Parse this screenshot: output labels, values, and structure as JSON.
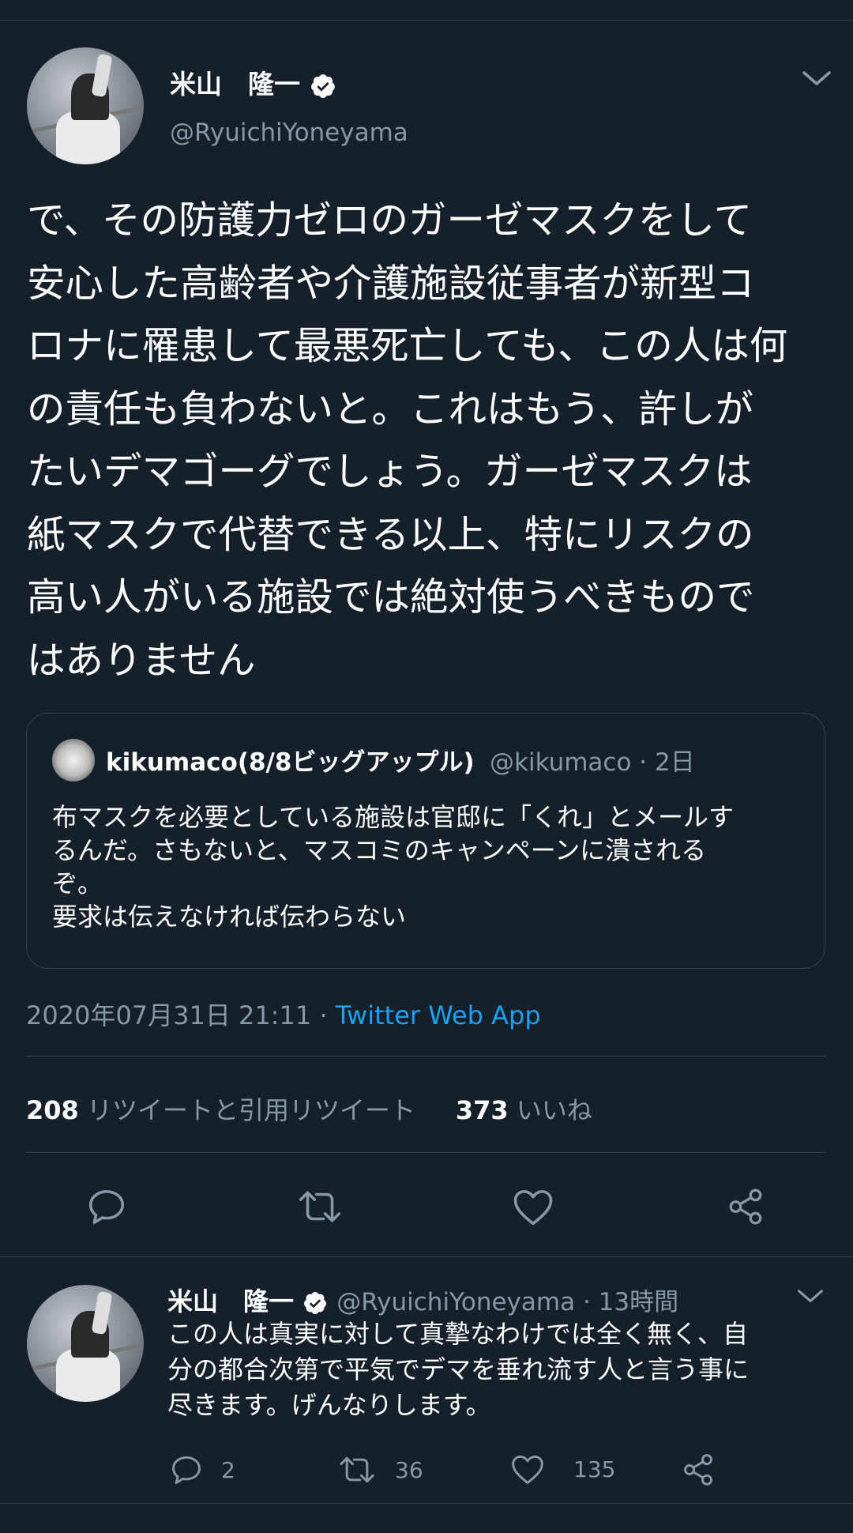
{
  "main_tweet": {
    "author_name": "米山　隆一",
    "author_handle": "@RyuichiYoneyama",
    "text_lines": [
      "で、その防護力ゼロのガーゼマスクをして",
      "安心した高齢者や介護施設従事者が新型コ",
      "ロナに罹患して最悪死亡しても、この人は何",
      "の責任も負わないと。これはもう、許しが",
      "たいデマゴーグでしょう。ガーゼマスクは",
      "紙マスクで代替できる以上、特にリスクの",
      "高い人がいる施設では絶対使うべきもので",
      "はありません"
    ],
    "timestamp": "2020年07月31日 21:11 · ",
    "source": "Twitter Web App",
    "retweet_count": "208",
    "retweet_label": "リツイートと引用リツイート",
    "like_count": "373",
    "like_label": "いいね"
  },
  "quoted_tweet": {
    "author_name": "kikumaco(8/8ビッグアップル)",
    "meta": "@kikumaco · 2日",
    "body_lines": [
      "布マスクを必要としている施設は官邸に「くれ」とメールす",
      "るんだ。さもないと、マスコミのキャンペーンに潰される",
      "ぞ。",
      "要求は伝えなければ伝わらない"
    ]
  },
  "reply_tweet": {
    "author_name": "米山　隆一",
    "meta": "@RyuichiYoneyama · 13時間",
    "text_lines": [
      "この人は真実に対して真摯なわけでは全く無く、自",
      "分の都合次第で平気でデマを垂れ流す人と言う事に",
      "尽きます。げんなりします。"
    ],
    "reply_count": "2",
    "retweet_count": "36",
    "like_count": "135"
  },
  "colors": {
    "background": "#15202b",
    "divider": "#38444d",
    "secondary_text": "#8899a6",
    "link": "#1da1f2",
    "verified_badge": "#ffffff"
  },
  "icons": [
    "verified-badge-icon",
    "chevron-down-icon",
    "reply-icon",
    "retweet-icon",
    "like-icon",
    "share-icon"
  ]
}
